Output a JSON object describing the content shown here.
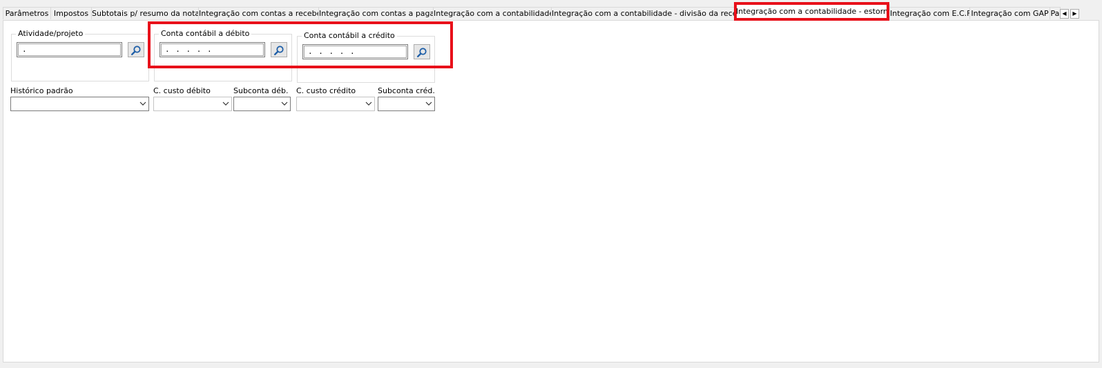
{
  "tabs": [
    {
      "label": "Parâmetros"
    },
    {
      "label": "Impostos"
    },
    {
      "label": "Subtotais p/ resumo da nota"
    },
    {
      "label": "Integração com contas a receber"
    },
    {
      "label": "Integração com contas a pagar"
    },
    {
      "label": "Integração com a contabilidade"
    },
    {
      "label": "Integração com a contabilidade - divisão da receita"
    },
    {
      "label": "Integração com a contabilidade - estorno",
      "active": true
    },
    {
      "label": "Integração com E.C.F"
    },
    {
      "label": "Integração com GAP"
    },
    {
      "label": "Pa"
    }
  ],
  "scroll": {
    "left": "◀",
    "right": "▶"
  },
  "form": {
    "atividade": {
      "legend": "Atividade/projeto",
      "value": "."
    },
    "debito": {
      "legend": "Conta contábil a débito",
      "value": ". . . . ."
    },
    "credito": {
      "legend": "Conta contábil a crédito",
      "value": ". . . . ."
    },
    "historico": {
      "label": "Histórico padrão",
      "value": ""
    },
    "custo_debito": {
      "label": "C. custo débito",
      "value": ""
    },
    "subconta_deb": {
      "label": "Subconta déb.",
      "value": ""
    },
    "custo_credito": {
      "label": "C. custo crédito",
      "value": ""
    },
    "subconta_cred": {
      "label": "Subconta créd.",
      "value": ""
    }
  },
  "colors": {
    "highlight": "#e8101a",
    "icon_blue": "#1f5fa8"
  },
  "icons": {
    "lookup": "search-icon",
    "dropdown": "chevron-down-icon"
  }
}
